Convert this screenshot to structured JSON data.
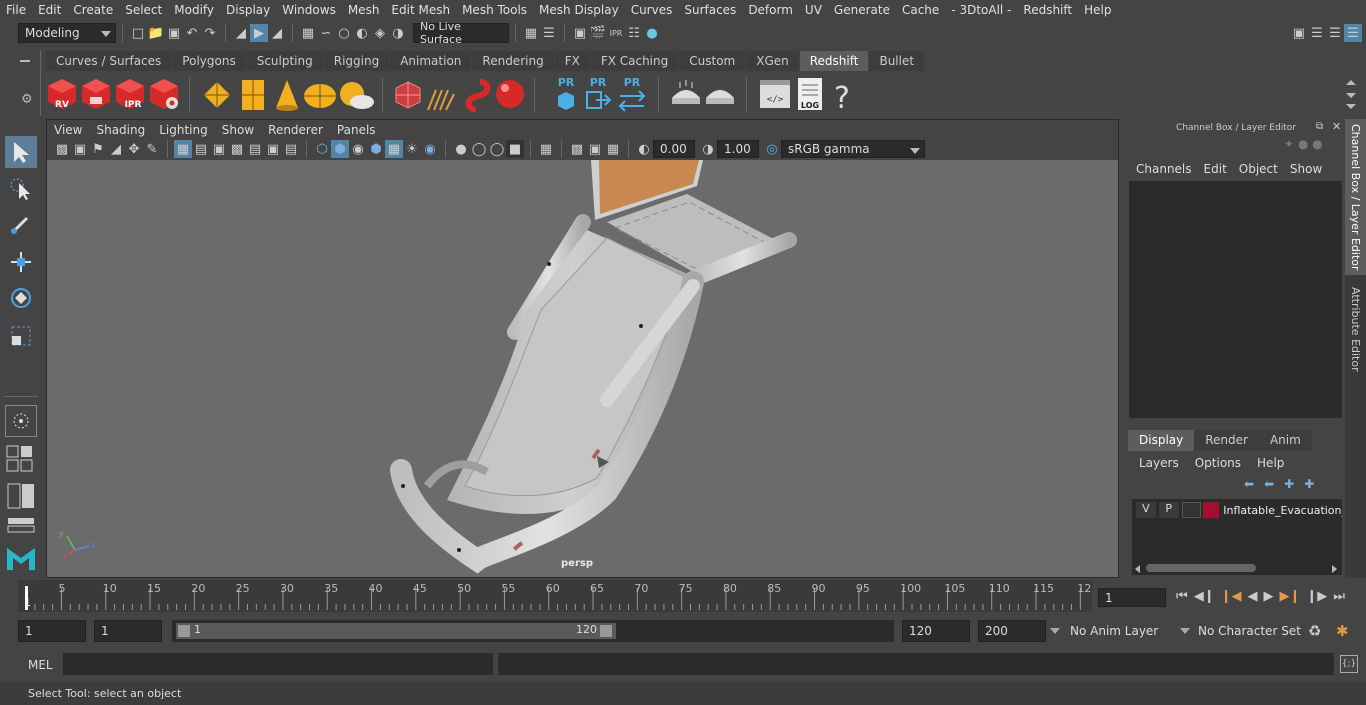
{
  "menu": [
    "File",
    "Edit",
    "Create",
    "Select",
    "Modify",
    "Display",
    "Windows",
    "Mesh",
    "Edit Mesh",
    "Mesh Tools",
    "Mesh Display",
    "Curves",
    "Surfaces",
    "Deform",
    "UV",
    "Generate",
    "Cache",
    "- 3DtoAll -",
    "Redshift",
    "Help"
  ],
  "status": {
    "mode": "Modeling",
    "live_surface": "No Live Surface"
  },
  "shelf_tabs": [
    "Curves / Surfaces",
    "Polygons",
    "Sculpting",
    "Rigging",
    "Animation",
    "Rendering",
    "FX",
    "FX Caching",
    "Custom",
    "XGen",
    "Redshift",
    "Bullet"
  ],
  "shelf_active": "Redshift",
  "shelf_icons": {
    "rv": "RV",
    "ipr": "IPR",
    "pr": "PR",
    "log": "LOG",
    "help": "?"
  },
  "viewport": {
    "menu": [
      "View",
      "Shading",
      "Lighting",
      "Show",
      "Renderer",
      "Panels"
    ],
    "exposure": "0.00",
    "gamma": "1.00",
    "colorspace": "sRGB gamma",
    "camera": "persp"
  },
  "channel_box": {
    "title": "Channel Box / Layer Editor",
    "menu": [
      "Channels",
      "Edit",
      "Object",
      "Show"
    ],
    "layer_tabs": [
      "Display",
      "Render",
      "Anim"
    ],
    "layer_active": "Display",
    "layer_menu": [
      "Layers",
      "Options",
      "Help"
    ],
    "layer": {
      "v": "V",
      "p": "P",
      "name": "Inflatable_Evacuation_",
      "color": "#a3102c"
    }
  },
  "side_tabs": [
    "Channel Box / Layer Editor",
    "Attribute Editor"
  ],
  "timeline": {
    "ticks": [
      "5",
      "10",
      "15",
      "20",
      "25",
      "30",
      "35",
      "40",
      "45",
      "50",
      "55",
      "60",
      "65",
      "70",
      "75",
      "80",
      "85",
      "90",
      "95",
      "100",
      "105",
      "110",
      "115",
      "12"
    ],
    "start_label": "1",
    "current_frame": "1"
  },
  "range": {
    "start": "1",
    "playback_start": "1",
    "slider_start": "1",
    "slider_end": "120",
    "end": "120",
    "anim_end": "200",
    "anim_layer": "No Anim Layer",
    "character_set": "No Character Set"
  },
  "mel": {
    "label": "MEL"
  },
  "help_line": "Select Tool: select an object"
}
